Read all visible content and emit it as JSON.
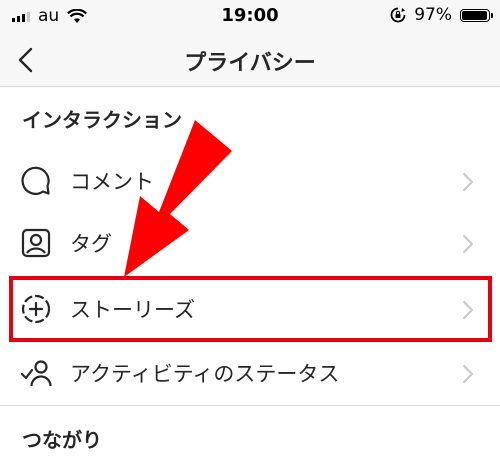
{
  "status_bar": {
    "carrier": "au",
    "time": "19:00",
    "battery": "97%",
    "battery_level": 0.97
  },
  "nav": {
    "title": "プライバシー",
    "back_icon": "chevron-left-icon"
  },
  "sections": {
    "interaction": {
      "header": "インタラクション",
      "items": [
        {
          "label": "コメント",
          "icon": "comment-icon"
        },
        {
          "label": "タグ",
          "icon": "tag-person-icon"
        },
        {
          "label": "ストーリーズ",
          "icon": "story-add-icon"
        },
        {
          "label": "アクティビティのステータス",
          "icon": "activity-status-icon"
        }
      ]
    },
    "connections": {
      "header": "つながり"
    }
  },
  "annotation": {
    "highlight_color": "#e60012",
    "arrow_color": "#ff0000"
  }
}
